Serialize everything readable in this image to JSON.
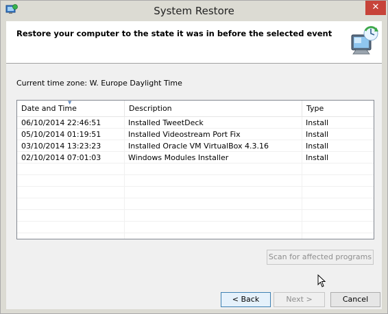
{
  "window": {
    "title": "System Restore",
    "close_glyph": "✕"
  },
  "header": {
    "title": "Restore your computer to the state it was in before the selected event",
    "icon": "system-restore-monitor-icon"
  },
  "timezone": {
    "label": "Current time zone: W. Europe Daylight Time"
  },
  "table": {
    "columns": [
      "Date and Time",
      "Description",
      "Type"
    ],
    "rows": [
      {
        "date": "06/10/2014 22:46:51",
        "description": "Installed TweetDeck",
        "type": "Install"
      },
      {
        "date": "05/10/2014 01:19:51",
        "description": "Installed Videostream Port Fix",
        "type": "Install"
      },
      {
        "date": "03/10/2014 13:23:23",
        "description": "Installed Oracle VM VirtualBox 4.3.16",
        "type": "Install"
      },
      {
        "date": "02/10/2014 07:01:03",
        "description": "Windows Modules Installer",
        "type": "Install"
      }
    ]
  },
  "buttons": {
    "scan": "Scan for affected programs",
    "back": "< Back",
    "next": "Next >",
    "cancel": "Cancel"
  },
  "colors": {
    "close": "#c7443a",
    "accent": "#3c7fb1"
  }
}
